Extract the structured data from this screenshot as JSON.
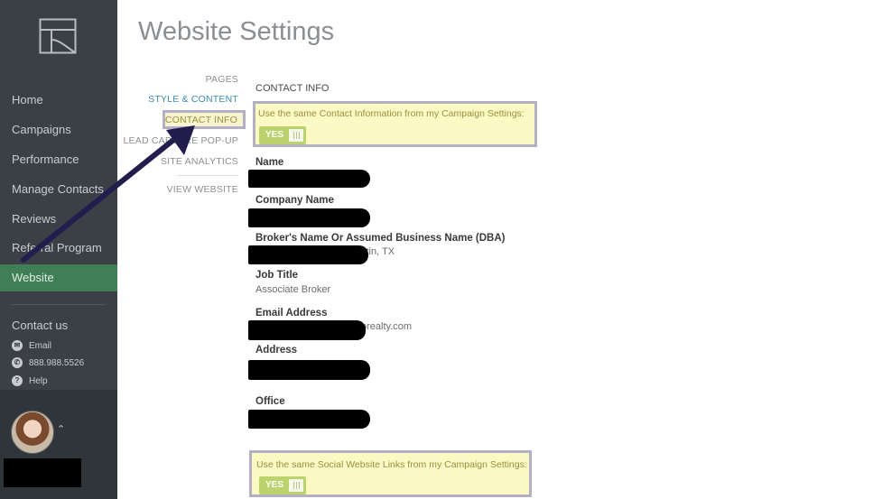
{
  "sidebar": {
    "nav": [
      {
        "label": "Home"
      },
      {
        "label": "Campaigns"
      },
      {
        "label": "Performance"
      },
      {
        "label": "Manage Contacts"
      },
      {
        "label": "Reviews"
      },
      {
        "label": "Referral Program"
      },
      {
        "label": "Website",
        "active": true
      }
    ],
    "contact": {
      "title": "Contact us",
      "email_label": "Email",
      "phone_label": "888.988.5526",
      "help_label": "Help"
    }
  },
  "page": {
    "title": "Website Settings"
  },
  "subnav": {
    "items": [
      "PAGES",
      "STYLE & CONTENT",
      "CONTACT INFO",
      "LEAD CAPTURE POP-UP",
      "SITE ANALYTICS",
      "VIEW WEBSITE"
    ],
    "active": "CONTACT INFO"
  },
  "contact_info": {
    "section_title": "CONTACT INFO",
    "same_contact_question": "Use the same Contact Information from my Campaign Settings:",
    "same_contact_toggle": "YES",
    "fields": {
      "name_label": "Name",
      "company_label": "Company Name",
      "broker_label": "Broker's Name Or Assumed Business Name (DBA)",
      "broker_value_partial": "stin, TX",
      "job_title_label": "Job Title",
      "job_title_value": "Associate Broker",
      "email_label": "Email Address",
      "email_value_partial": "orealty.com",
      "address_label": "Address",
      "office_label": "Office"
    },
    "same_social_question": "Use the same Social Website Links from my Campaign Settings:",
    "same_social_toggle": "YES"
  },
  "colors": {
    "sidebar_bg": "#3a4046",
    "active_nav": "#3f7e57",
    "toggle_on": "#bcd36d",
    "highlight_bg": "#fbf9c4",
    "annotation_border": "#b4afc4",
    "arrow": "#231d4e"
  },
  "icons": [
    "logo-icon",
    "email-icon",
    "phone-icon",
    "help-icon",
    "chevron-up-icon"
  ]
}
